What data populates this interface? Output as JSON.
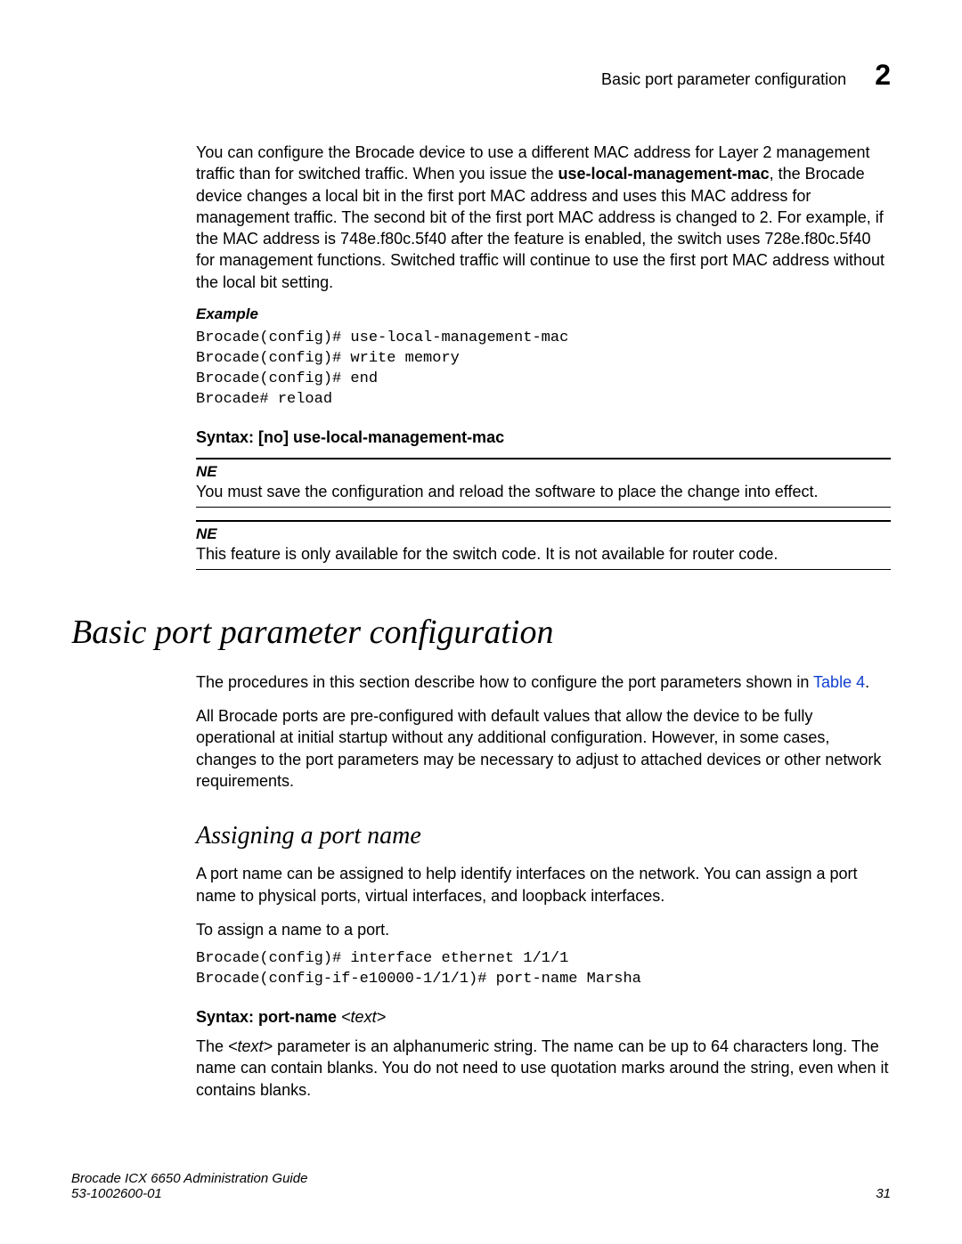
{
  "header": {
    "title": "Basic port parameter configuration",
    "chapter_number": "2"
  },
  "intro_paragraph": {
    "pre": "You can configure the Brocade device to use a different MAC address for Layer 2 management traffic than for switched traffic.  When you issue the ",
    "bold1": "use-local-management-mac",
    "mid": ", the Brocade device changes a local bit in the first port MAC address and uses this MAC address for management traffic. The second bit of the first port MAC address is changed to 2. For example, if the MAC address is 748e.f80c.5f40 after the feature is enabled, the switch uses 728e.f80c.5f40 for management functions. Switched traffic will continue to use the first port MAC address without the local bit setting."
  },
  "example_label": "Example",
  "code_block_1": "Brocade(config)# use-local-management-mac\nBrocade(config)# write memory\nBrocade(config)# end\nBrocade# reload",
  "syntax1": {
    "label": "Syntax:",
    "command": " [no] use-local-management-mac"
  },
  "note1": {
    "title": "NE",
    "text": "You must save the configuration and reload the software to place the change into effect."
  },
  "note2": {
    "title": "NE",
    "text": "This feature is only available for the switch code. It is not available for router code."
  },
  "section_title": "Basic port parameter configuration",
  "section_para1": {
    "pre": "The procedures in this section describe how to configure the port parameters shown in ",
    "link": "Table 4",
    "post": "."
  },
  "section_para2": "All Brocade ports are pre-configured with default values that allow the device to be fully operational at initial startup without any additional configuration.  However, in some cases, changes to the port parameters may be necessary to adjust to attached devices or other network requirements.",
  "subsection_title": "Assigning a port name",
  "sub_para1": "A port name can be assigned to help identify interfaces on the network.  You can assign a port name to physical ports, virtual interfaces, and loopback interfaces.",
  "sub_para2": "To assign a name to a port.",
  "code_block_2": "Brocade(config)# interface ethernet 1/1/1\nBrocade(config-if-e10000-1/1/1)# port-name Marsha",
  "syntax2": {
    "label": "Syntax: ",
    "command": " port-name ",
    "arg": "<text>"
  },
  "syntax2_para": {
    "pre": "The ",
    "arg": "<text>",
    "post": " parameter is an alphanumeric string.  The name can be up to 64 characters long.  The name can contain blanks.  You do not need to use quotation marks around the string, even when it contains blanks."
  },
  "footer": {
    "doc_title": "Brocade ICX 6650 Administration Guide",
    "doc_number": "53-1002600-01",
    "page_number": "31"
  }
}
